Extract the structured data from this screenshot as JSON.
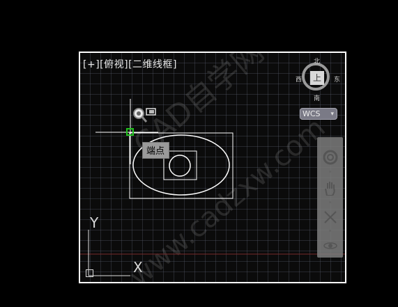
{
  "viewport": {
    "label": "[+][俯视][二维线框]"
  },
  "tooltip": {
    "text": "端点"
  },
  "viewcube": {
    "north": "北",
    "south": "南",
    "west": "西",
    "east": "东",
    "face": "上"
  },
  "wcs": {
    "label": "WCS",
    "arrow": "▾"
  },
  "ucs": {
    "x_label": "X",
    "y_label": "Y"
  },
  "watermark": {
    "text1": "CAD自学网",
    "text2": "www.cadzxw.com"
  },
  "navbar": {
    "tools": [
      "steering-wheel-icon",
      "pan-hand-icon",
      "zoom-extents-icon",
      "orbit-icon"
    ]
  },
  "colors": {
    "snap_marker": "#21c21e",
    "x_axis_line": "#7a2a2a",
    "background": "#0b0b0b"
  }
}
